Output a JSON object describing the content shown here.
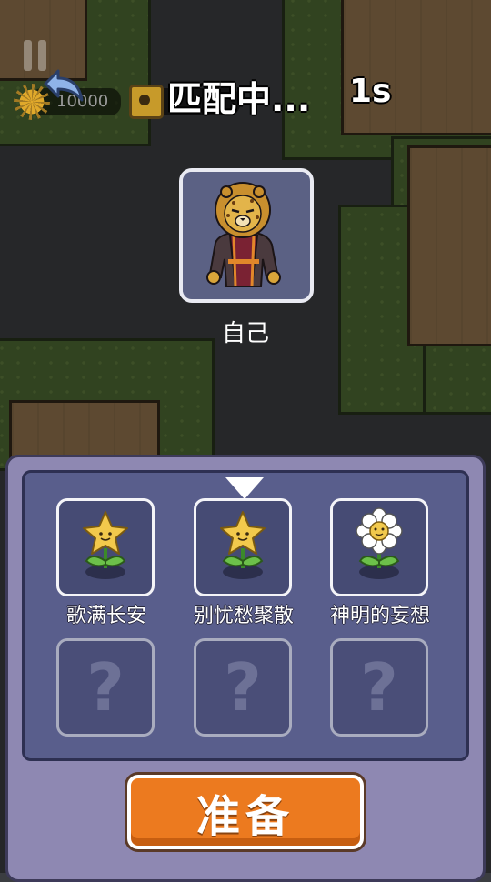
{
  "hud": {
    "sun_count": "10000",
    "seed_count": "",
    "match_title": "匹配中...",
    "match_timer": "1s"
  },
  "player": {
    "name": "自己",
    "avatar_icon": "leopard-character-icon"
  },
  "slots": [
    {
      "label": "歌满长安",
      "icon": "star-flower-icon",
      "filled": true
    },
    {
      "label": "别忧愁聚散",
      "icon": "star-flower-icon",
      "filled": true,
      "selected": true
    },
    {
      "label": "神明的妄想",
      "icon": "daisy-flower-icon",
      "filled": true
    },
    {
      "label": "",
      "icon": "question-mark-icon",
      "filled": false,
      "symbol": "?"
    },
    {
      "label": "",
      "icon": "question-mark-icon",
      "filled": false,
      "symbol": "?"
    },
    {
      "label": "",
      "icon": "question-mark-icon",
      "filled": false,
      "symbol": "?"
    }
  ],
  "ready_button": {
    "label": "准备"
  },
  "colors": {
    "panel": "#8e88b2",
    "inner_panel": "#595e8c",
    "ready_button": "#ec7a1f"
  }
}
